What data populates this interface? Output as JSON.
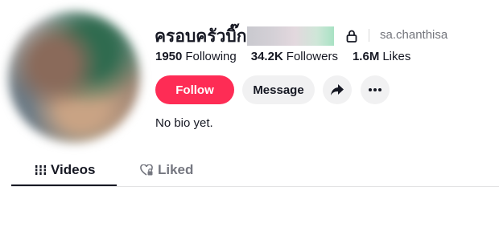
{
  "profile": {
    "display_name": "ครอบครัวบิ๊ก",
    "username": "sa.chanthisa",
    "bio": "No bio yet."
  },
  "stats": {
    "following_count": "1950",
    "following_label": "Following",
    "followers_count": "34.2K",
    "followers_label": "Followers",
    "likes_count": "1.6M",
    "likes_label": "Likes"
  },
  "actions": {
    "follow_label": "Follow",
    "message_label": "Message",
    "share_icon": "share-arrow-icon",
    "more_icon": "more-dots-icon"
  },
  "tabs": [
    {
      "label": "Videos",
      "icon": "grid-icon",
      "active": true
    },
    {
      "label": "Liked",
      "icon": "heart-lock-icon",
      "active": false
    }
  ],
  "colors": {
    "accent": "#fe2c55",
    "secondary_button": "#f1f1f2",
    "text_primary": "#161823",
    "text_muted": "#73757c"
  }
}
